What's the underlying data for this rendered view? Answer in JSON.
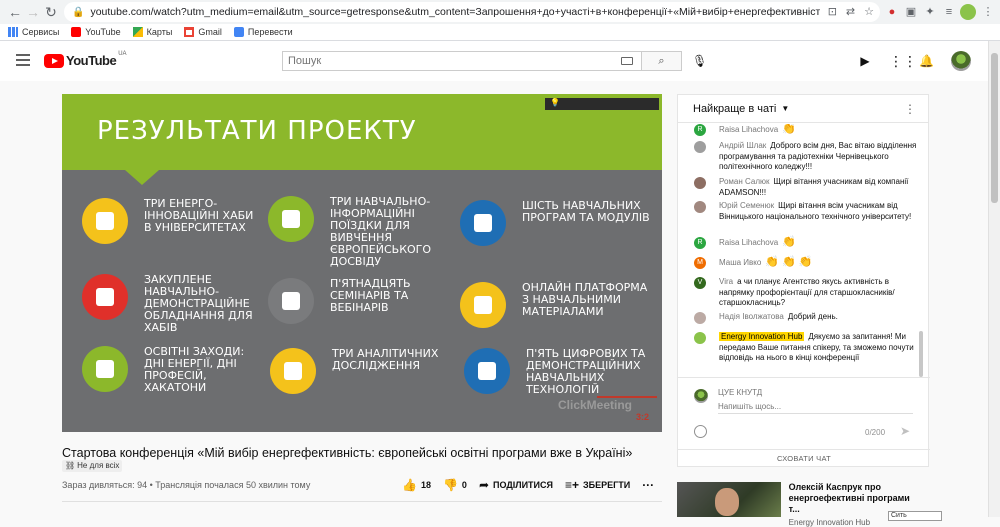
{
  "browser": {
    "url": "youtube.com/watch?utm_medium=email&utm_source=getresponse&utm_content=Запрошення+до+участі+в+конференції+«Мій+вибір+енергефективність%3A+європейські+ос...",
    "bookmarks": [
      {
        "label": "Сервисы"
      },
      {
        "label": "YouTube"
      },
      {
        "label": "Карты"
      },
      {
        "label": "Gmail"
      },
      {
        "label": "Перевести"
      }
    ]
  },
  "header": {
    "logo_text": "YouTube",
    "logo_country": "UA",
    "search_placeholder": "Пошук"
  },
  "slide": {
    "title": "РЕЗУЛЬТАТИ ПРОЕКТУ",
    "items": [
      {
        "text": "ТРИ ЕНЕРГО-ІННОВАЦІЙНІ ХАБИ В УНІВЕРСИТЕТАХ",
        "color": "#f4c21b"
      },
      {
        "text": "ТРИ НАВЧАЛЬНО-ІНФОРМАЦІЙНІ ПОЇЗДКИ ДЛЯ ВИВЧЕННЯ ЄВРОПЕЙСЬКОГО ДОСВІДУ",
        "color": "#8cb82b"
      },
      {
        "text": "ШІСТЬ НАВЧАЛЬНИХ ПРОГРАМ ТА МОДУЛІВ",
        "color": "#1f6eb4"
      },
      {
        "text": "ЗАКУПЛЕНЕ НАВЧАЛЬНО-ДЕМОНСТРАЦІЙНЕ ОБЛАДНАННЯ ДЛЯ ХАБІВ",
        "color": "#e0302a"
      },
      {
        "text": "П'ЯТНАДЦЯТЬ СЕМІНАРІВ ТА ВЕБІНАРІВ",
        "color": "#7a7b7d"
      },
      {
        "text": "ОНЛАЙН ПЛАТФОРМА З НАВЧАЛЬНИМИ МАТЕРІАЛАМИ",
        "color": "#f4c21b"
      },
      {
        "text": "ОСВІТНІ ЗАХОДИ: ДНІ ЕНЕРГІЇ, ДНІ ПРОФЕСІЙ, ХАКАТОНИ",
        "color": "#8cb82b"
      },
      {
        "text": "ТРИ АНАЛІТИЧНИХ ДОСЛІДЖЕННЯ",
        "color": "#f4c21b"
      },
      {
        "text": "П'ЯТЬ ЦИФРОВИХ ТА ДЕМОНСТРАЦІЙНИХ НАВЧАЛЬНИХ ТЕХНОЛОГІЙ",
        "color": "#1f6eb4"
      }
    ],
    "watermark": "ClickMeeting",
    "watermark_badge": "3:2"
  },
  "video": {
    "title": "Стартова конференція «Мій вибір енергефективність: європейські освітні програми вже в Україні»",
    "tag": "Не для всіх",
    "views": "Зараз дивляться: 94 • Трансляція почалася 50 хвилин тому",
    "likes": "18",
    "dislikes": "0",
    "share_label": "ПОДІЛИТИСЯ",
    "save_label": "ЗБЕРЕГТИ"
  },
  "chat": {
    "header": "Найкраще в чаті",
    "messages": [
      {
        "author": "Raisa Lihachova",
        "text": "👏",
        "av": "R",
        "color": "#2ba640"
      },
      {
        "author": "Андрій Шлак",
        "text": "Доброго всім дня, Вас вітаю відділення програмування та радіотехніки Чернівецького політехнічного коледжу!!!",
        "av": "",
        "color": "#9e9e9e"
      },
      {
        "author": "Роман Салюк",
        "text": "Щирі вітання учасникам від компанії ADAMSON!!!",
        "av": "",
        "color": "#8d6e63"
      },
      {
        "author": "Юрій Семенюк",
        "text": "Щирі вітання всім учасникам від Вінницького національного технічного університету!",
        "av": "",
        "color": "#a1887f"
      },
      {
        "author": "Raisa Lihachova",
        "text": "👏",
        "av": "R",
        "color": "#2ba640"
      },
      {
        "author": "Маша Ивко",
        "text": "👏 👏 👏",
        "av": "М",
        "color": "#ef6c00"
      },
      {
        "author": "Vira",
        "text": "а чи планує Агентство якусь активність в напрямку профорієнтації для старшокласників/старшокласниць?",
        "av": "V",
        "color": "#33691e"
      },
      {
        "author": "Надія Іволжатова",
        "text": "Добрий день.",
        "av": "",
        "color": "#bcaaa4"
      },
      {
        "author": "Energy Innovation Hub",
        "text": "Дякуємо за запитання! Ми передамо Ваше питання спікеру, та зможемо почути відповідь на нього в кінці конференції",
        "av": "",
        "color": "#8bc34a"
      }
    ],
    "me_name": "ЦУЕ КНУТД",
    "input_placeholder": "Напишіть щось...",
    "counter": "0/200",
    "hide_label": "СХОВАТИ ЧАТ"
  },
  "recommendation": {
    "title": "Олексій Каспрук про енергоефективні програми т...",
    "channel": "Energy Innovation Hub",
    "tooltip": "Сить"
  }
}
